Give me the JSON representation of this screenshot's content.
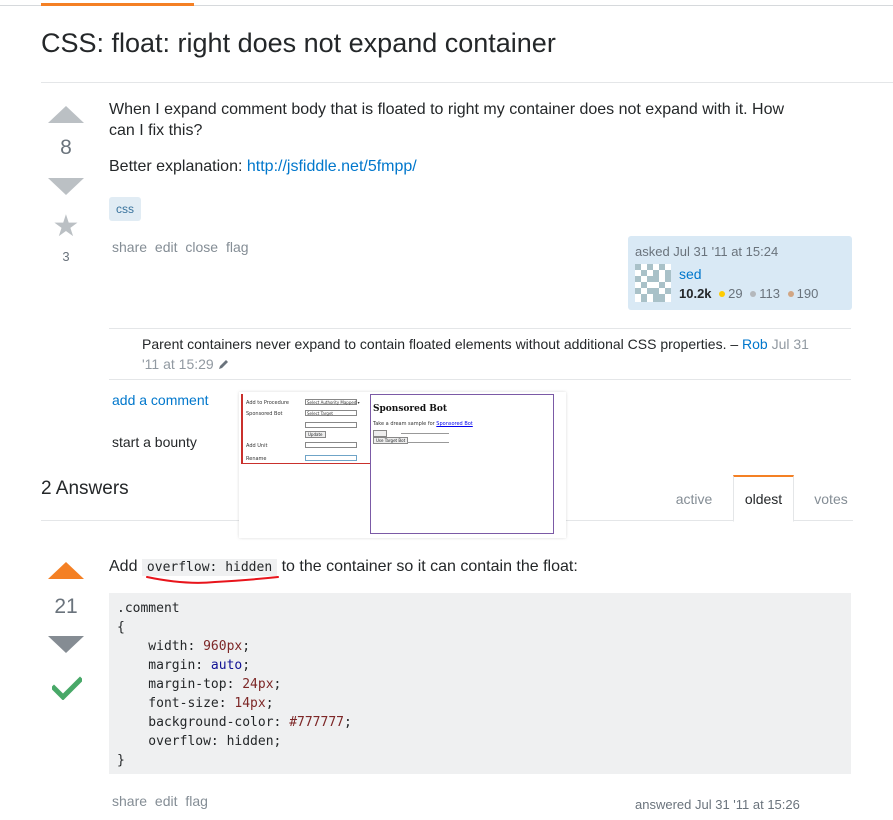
{
  "question": {
    "title": "CSS: float: right does not expand container",
    "votes": "8",
    "favorites": "3",
    "body_line1": "When I expand comment body that is floated to right my container does not expand with it. How",
    "body_line2": "can I fix this?",
    "explanation_label": "Better explanation: ",
    "explanation_link": "http://jsfiddle.net/5fmpp/",
    "tag": "css",
    "menu": [
      "share",
      "edit",
      "close",
      "flag"
    ],
    "owner": {
      "asked": "asked Jul 31 '11 at 15:24",
      "name": "sed",
      "reputation": "10.2k",
      "gold": "29",
      "silver": "113",
      "bronze": "190",
      "gold_color": "#ffcc01",
      "silver_color": "#b4b8bc",
      "bronze_color": "#d1a684"
    }
  },
  "comment": {
    "text": "Parent containers never expand to contain floated elements without additional CSS properties. – ",
    "author": "Rob",
    "date_part1": " Jul 31",
    "date_part2": "'11 at 15:29",
    "edit_icon": "pencil-icon"
  },
  "actions": {
    "add_comment": "add a comment",
    "start_bounty": "start a bounty"
  },
  "sponsored_popup": {
    "title": "Sponsored Bot",
    "description": "Take a dream sample for",
    "link": "Sponsored Bot",
    "left_labels": [
      "Add to Procedure",
      "Sponsored Bot",
      "Add Unit",
      "Rename"
    ],
    "dropdown1": "Select Authority Mapped ▾",
    "dropdown2": "Select Target",
    "button1": "Update",
    "button2": "Use Target Bot"
  },
  "answers": {
    "header": "2 Answers",
    "tabs": [
      "active",
      "oldest",
      "votes"
    ],
    "active_tab": "oldest"
  },
  "answer": {
    "votes": "21",
    "text_before": "Add ",
    "inline_code": "overflow: hidden",
    "text_after": " to the container so it can contain the float:",
    "menu": [
      "share",
      "edit",
      "flag"
    ],
    "answered": "answered Jul 31 '11 at 15:26",
    "accent_color": "#f48024",
    "accept_color": "#48a868"
  }
}
